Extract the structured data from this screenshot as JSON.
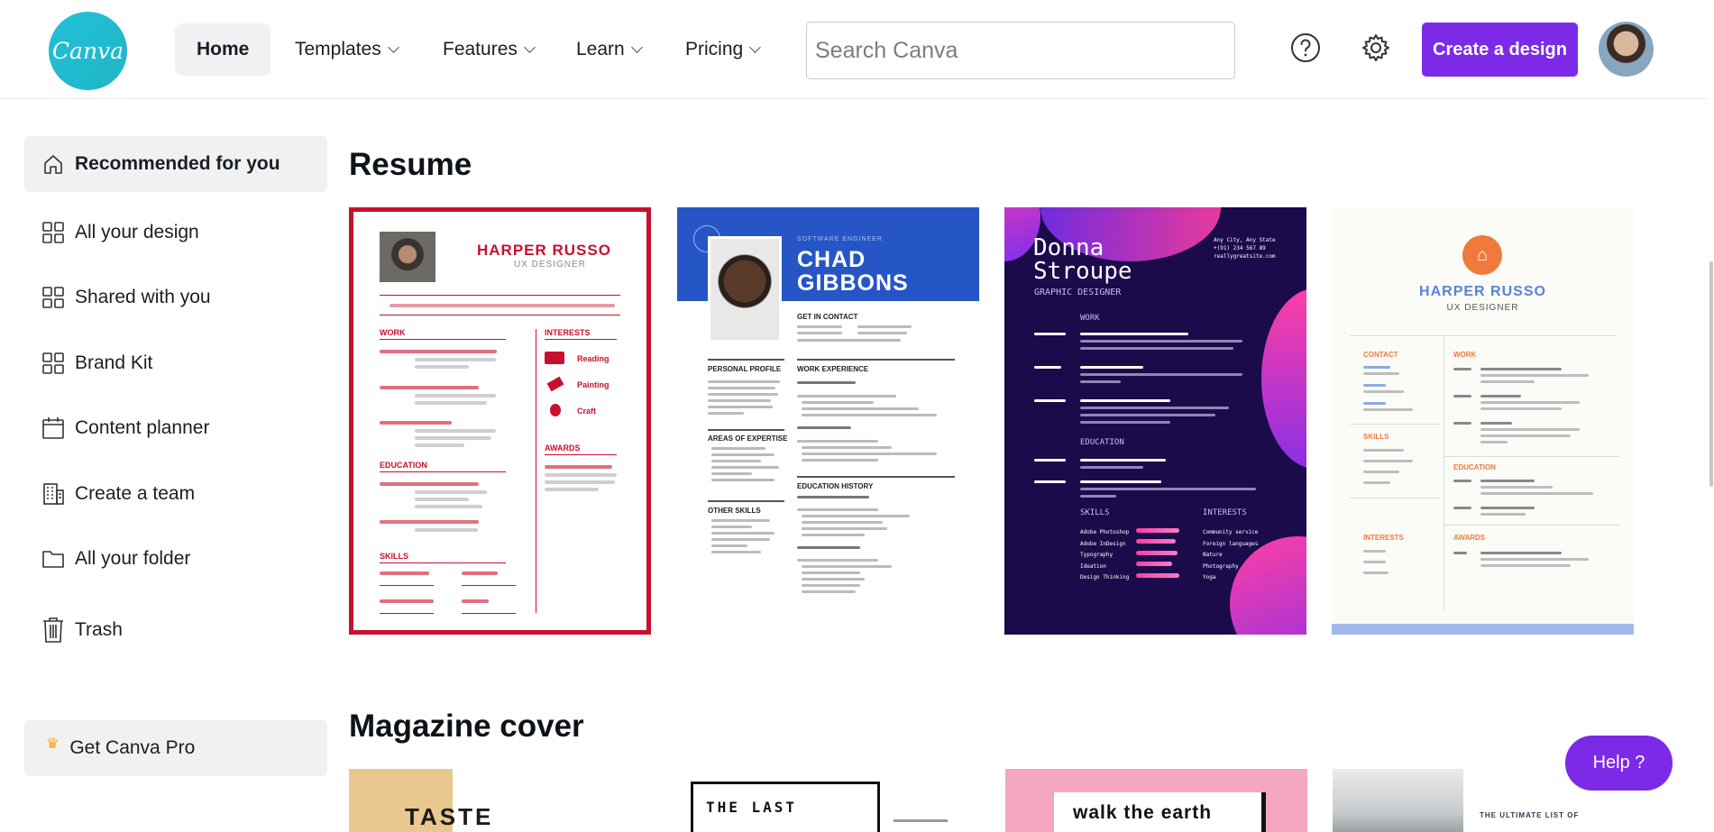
{
  "header": {
    "logo_text": "Canva",
    "nav": [
      {
        "label": "Home"
      },
      {
        "label": "Templates"
      },
      {
        "label": "Features"
      },
      {
        "label": "Learn"
      },
      {
        "label": "Pricing"
      }
    ],
    "search_placeholder": "Search Canva",
    "create_label": "Create a design",
    "accent": "#7d2ae8"
  },
  "sidebar": {
    "items": [
      {
        "label": "Recommended for you",
        "icon": "home-icon"
      },
      {
        "label": "All your design",
        "icon": "grid-icon"
      },
      {
        "label": "Shared with you",
        "icon": "grid-icon"
      },
      {
        "label": "Brand Kit",
        "icon": "grid-icon"
      },
      {
        "label": "Content planner",
        "icon": "calendar-icon"
      },
      {
        "label": "Create a team",
        "icon": "building-icon"
      },
      {
        "label": "All your folder",
        "icon": "folder-icon"
      },
      {
        "label": "Trash",
        "icon": "trash-icon"
      }
    ],
    "pro_label": "Get Canva Pro"
  },
  "sections": {
    "resume_title": "Resume",
    "magazine_title": "Magazine cover"
  },
  "resume_cards": {
    "c1": {
      "name": "HARPER RUSSO",
      "role": "UX DESIGNER",
      "h_work": "WORK",
      "h_interests": "INTERESTS",
      "h_education": "EDUCATION",
      "h_awards": "AWARDS",
      "h_skills": "SKILLS",
      "i1": "Reading",
      "i2": "Painting",
      "i3": "Craft"
    },
    "c2": {
      "role": "SOFTWARE ENGINEER",
      "name_1": "CHAD",
      "name_2": "GIBBONS",
      "h_contact": "GET IN CONTACT",
      "h_profile": "PERSONAL PROFILE",
      "h_experience": "WORK EXPERIENCE",
      "h_expertise": "AREAS OF EXPERTISE",
      "h_education": "EDUCATION HISTORY",
      "h_skills": "OTHER SKILLS"
    },
    "c3": {
      "name_1": "Donna",
      "name_2": "Stroupe",
      "role": "GRAPHIC DESIGNER",
      "contact_1": "Any City, Any State",
      "contact_2": "+(91) 234 567 89",
      "contact_3": "reallygreatsite.com",
      "h_work": "WORK",
      "h_education": "EDUCATION",
      "h_skills": "SKILLS",
      "h_interests": "INTERESTS",
      "skills": [
        "Adobe Photoshop",
        "Adobe InDesign",
        "Typography",
        "Ideation",
        "Design Thinking"
      ],
      "interests": [
        "Community service",
        "Foreign languages",
        "Nature",
        "Photography",
        "Yoga"
      ]
    },
    "c4": {
      "name": "HARPER RUSSO",
      "role": "UX DESIGNER",
      "h_contact": "CONTACT",
      "h_work": "WORK",
      "h_skills": "SKILLS",
      "h_education": "EDUCATION",
      "h_interests": "INTERESTS",
      "h_awards": "AWARDS"
    }
  },
  "magazine_cards": {
    "m1": "TASTE",
    "m2": "THE LAST",
    "m3": "walk the earth",
    "m4": "THE ULTIMATE LIST OF"
  },
  "help_label": "Help ?"
}
